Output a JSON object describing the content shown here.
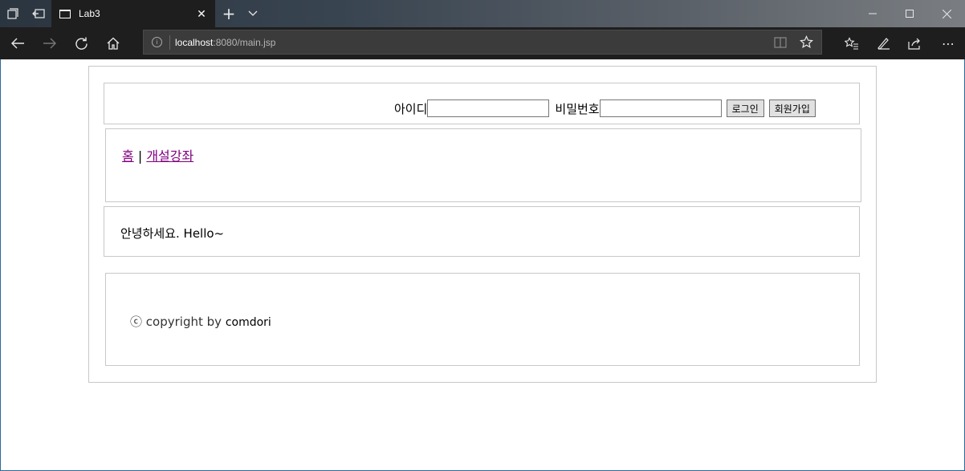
{
  "browser": {
    "tab_title": "Lab3",
    "url_host": "localhost",
    "url_rest": ":8080/main.jsp"
  },
  "header": {
    "id_label": "아이디",
    "password_label": "비밀번호",
    "id_value": "",
    "password_value": "",
    "login_button": "로그인",
    "signup_button": "회원가입"
  },
  "nav": {
    "home_link": "홈",
    "separator": "|",
    "courses_link": "개설강좌"
  },
  "main": {
    "greeting": "안녕하세요. Hello~"
  },
  "footer": {
    "copyright_symbol": "ⓒ",
    "copyright_text": "copyright by",
    "author": "comdori"
  }
}
